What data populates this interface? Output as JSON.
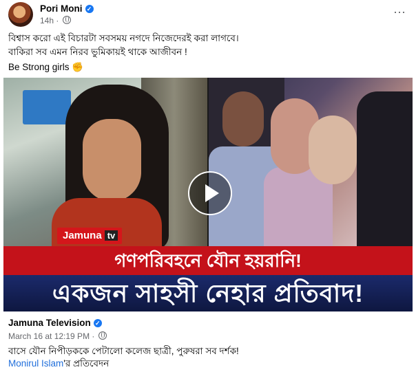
{
  "post": {
    "author": "Pori Moni",
    "time": "14h",
    "more_icon": "⋯",
    "line1": "বিশ্বাস করো এই বিচারটা সবসময় নগদে নিজেদেরই করা লাগবে।",
    "line2": "বাকিরা সব এমন নিরব ভুমিকায়ই থাকে আজীবন !",
    "line3": "Be Strong girls",
    "emoji": "✊"
  },
  "video": {
    "logo": "Jamuna",
    "logo_suffix": "tv",
    "headline1": "গণপরিবহনে যৌন হয়রানি!",
    "headline2": "একজন সাহসী নেহার প্রতিবাদ!"
  },
  "shared": {
    "author": "Jamuna Television",
    "time": "March 16 at 12:19 PM",
    "separator": " · ",
    "text": "বাসে যৌন নিপীড়ককে পেটালো কলেজ ছাত্রী, পুরুষরা সব দর্শক!",
    "link_name": "Monirul Islam",
    "link_suffix": "'র প্রতিবেদন"
  },
  "colors": {
    "accent": "#1877f2",
    "link": "#216fdb",
    "red_band": "#c4121a",
    "navy_band": "#1b2a6b"
  }
}
